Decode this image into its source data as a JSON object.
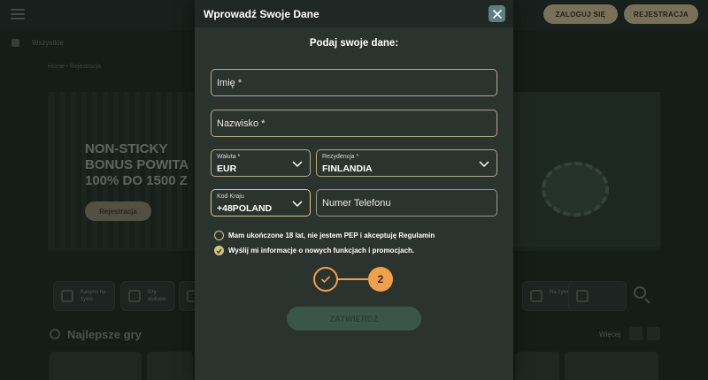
{
  "modal": {
    "title": "Wprowadź Swoje Dane",
    "subtitle": "Podaj swoje dane:",
    "first_name_placeholder": "Imię *",
    "last_name_placeholder": "Nazwisko *",
    "currency": {
      "label": "Waluta *",
      "value": "EUR"
    },
    "residence": {
      "label": "Rezydencja *",
      "value": "FINLANDIA"
    },
    "country_code": {
      "label": "Kod Kraju",
      "value": "+48POLAND"
    },
    "phone_placeholder": "Numer Telefonu",
    "checkbox_terms": {
      "label": "Mam ukończone 18 lat, nie jestem PEP i akceptuję Regulamin",
      "checked": false
    },
    "checkbox_marketing": {
      "label": "Wyślij mi informacje o nowych funkcjach i promocjach.",
      "checked": true
    },
    "steps": {
      "current_step": "2"
    },
    "submit_label": "ZATWIERDŹ"
  },
  "background": {
    "header": {
      "login_label": "ZALOGUJ SIĘ",
      "register_label": "REJESTRACJA"
    },
    "subnav_label": "Wszystkie",
    "breadcrumb": "Home • Rejestracja",
    "hero": {
      "title_line1": "NON-STICKY",
      "title_line2": "BONUS POWITA",
      "title_line3": "100% DO 1500 Z",
      "button_label": "Rejestracja"
    },
    "categories": [
      {
        "label": "Kasyno na żywo"
      },
      {
        "label": "Gry stołowe"
      },
      {
        "label": "Na żywo"
      }
    ],
    "games_title": "Najlepsze gry",
    "more_label": "Więcej"
  },
  "colors": {
    "accent_gold": "#b4a983",
    "step_orange": "#f1a04a",
    "modal_bg": "#2b332f",
    "submit_disabled": "#3a564a"
  }
}
